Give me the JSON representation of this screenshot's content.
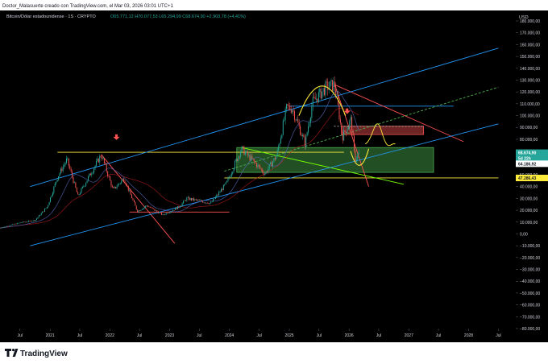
{
  "header": {
    "author_line": "Doctor_Malasuerte creado con TradingView.com, el Mar 03, 2026 03:01 UTC+1",
    "symbol": "Bitcoin/Dólar estadounidense · 1S · CRYPTO",
    "ohlc": "O65.771,12 H70.077,53 L65.294,99 C68.674,90 +2.903,78 (+4,41%)"
  },
  "footer": {
    "brand": "TradingView",
    "logo_icon": "tradingview-logo-icon"
  },
  "colors": {
    "background": "#000000",
    "up": "#26a69a",
    "down": "#ef5350",
    "channel": "#2196f3",
    "support_zone": "#4caf50",
    "annotation": "#ffeb3b",
    "trend_down": "#ff5252",
    "trend_up": "#76ff03"
  },
  "chart_data": {
    "type": "candlestick",
    "currency_label": "USD",
    "y_ticks": [
      "180.000,00",
      "170.000,00",
      "160.000,00",
      "150.000,00",
      "140.000,00",
      "130.000,00",
      "120.000,00",
      "110.000,00",
      "100.000,00",
      "90.000,00",
      "80.000,00",
      "70.000,00",
      "60.000,00",
      "50.000,00",
      "40.000,00",
      "30.000,00",
      "20.000,00",
      "10.000,00",
      "0,00",
      "−10.000,00",
      "−20.000,00",
      "−30.000,00",
      "−40.000,00",
      "−50.000,00",
      "−60.000,00",
      "−70.000,00",
      "−80.000,00"
    ],
    "ylim": [
      -80000,
      180000
    ],
    "x_ticks": [
      {
        "label": "Jul",
        "date": "2020-07-01"
      },
      {
        "label": "2021",
        "date": "2021-01-01"
      },
      {
        "label": "Jul",
        "date": "2021-07-01"
      },
      {
        "label": "2022",
        "date": "2022-01-01"
      },
      {
        "label": "Jul",
        "date": "2022-07-01"
      },
      {
        "label": "2023",
        "date": "2023-01-01"
      },
      {
        "label": "Jul",
        "date": "2023-07-01"
      },
      {
        "label": "2024",
        "date": "2024-01-01"
      },
      {
        "label": "Jul",
        "date": "2024-07-01"
      },
      {
        "label": "2025",
        "date": "2025-01-01"
      },
      {
        "label": "Jul",
        "date": "2025-07-01"
      },
      {
        "label": "2026",
        "date": "2026-01-01"
      },
      {
        "label": "Jul",
        "date": "2026-07-01"
      },
      {
        "label": "2027",
        "date": "2027-01-01"
      },
      {
        "label": "Jul",
        "date": "2027-07-01"
      },
      {
        "label": "2028",
        "date": "2028-01-01"
      },
      {
        "label": "Jul",
        "date": "2028-07-01"
      }
    ],
    "price_path": [
      [
        "2020-03-01",
        5000
      ],
      [
        "2020-07-01",
        9500
      ],
      [
        "2020-10-01",
        11500
      ],
      [
        "2020-12-15",
        23000
      ],
      [
        "2021-02-15",
        48000
      ],
      [
        "2021-04-14",
        63000
      ],
      [
        "2021-06-20",
        32000
      ],
      [
        "2021-08-20",
        47000
      ],
      [
        "2021-11-10",
        67000
      ],
      [
        "2022-01-20",
        37000
      ],
      [
        "2022-03-28",
        47000
      ],
      [
        "2022-06-18",
        19000
      ],
      [
        "2022-08-15",
        24000
      ],
      [
        "2022-11-20",
        16000
      ],
      [
        "2023-03-01",
        23000
      ],
      [
        "2023-04-15",
        30000
      ],
      [
        "2023-09-10",
        26000
      ],
      [
        "2023-12-15",
        43000
      ],
      [
        "2024-03-14",
        72000
      ],
      [
        "2024-08-05",
        51000
      ],
      [
        "2024-10-15",
        66000
      ],
      [
        "2024-12-17",
        107000
      ],
      [
        "2025-01-20",
        106000
      ],
      [
        "2025-04-07",
        76000
      ],
      [
        "2025-05-22",
        111000
      ],
      [
        "2025-08-14",
        124000
      ],
      [
        "2025-10-06",
        126000
      ],
      [
        "2025-11-21",
        82000
      ],
      [
        "2026-01-14",
        97000
      ],
      [
        "2026-02-05",
        62000
      ],
      [
        "2026-03-02",
        68674.9
      ]
    ],
    "price_labels": [
      {
        "text": "68.674,90",
        "value": 68674.9,
        "color": "#26a69a"
      },
      {
        "text": "5d 22h",
        "value": 63800,
        "color": "#26a69a"
      },
      {
        "text": "64.186,92",
        "value": 59300,
        "color": "#ffffff"
      },
      {
        "text": "47.286,43",
        "value": 47286.43,
        "color": "#ffeb3b"
      }
    ],
    "horizontal_levels": [
      {
        "value": 69000,
        "from": "2021-02-15",
        "to": "2025-12-01",
        "color": "#ffeb3b"
      },
      {
        "value": 47286.43,
        "from": "2023-12-01",
        "to": "2028-07-01",
        "color": "#ffeb3b"
      },
      {
        "value": 18500,
        "from": "2022-05-01",
        "to": "2024-01-01",
        "color": "#ff5252"
      },
      {
        "value": 108000,
        "from": "2025-01-01",
        "to": "2027-10-01",
        "color": "#2196f3"
      },
      {
        "value": 91000,
        "from": "2025-10-01",
        "to": "2027-04-01",
        "color": "#9e9e9e"
      }
    ],
    "zones": [
      {
        "from": "2024-02-15",
        "to": "2027-06-01",
        "low": 52000,
        "high": 73000,
        "color": "#4caf50"
      },
      {
        "from": "2025-11-15",
        "to": "2027-04-01",
        "low": 84000,
        "high": 91000,
        "color": "#ef5350"
      }
    ],
    "trendlines": [
      {
        "p1": [
          "2021-11-10",
          67000
        ],
        "p2": [
          "2023-02-01",
          -8000
        ],
        "color": "#ff5252"
      },
      {
        "p1": [
          "2025-10-06",
          126000
        ],
        "p2": [
          "2026-05-01",
          40000
        ],
        "color": "#ff5252"
      },
      {
        "p1": [
          "2025-10-06",
          126000
        ],
        "p2": [
          "2027-12-01",
          78000
        ],
        "color": "#ff5252"
      },
      {
        "p1": [
          "2024-03-14",
          73000
        ],
        "p2": [
          "2026-12-01",
          42000
        ],
        "color": "#76ff03"
      },
      {
        "p1": [
          "2020-09-01",
          -10000
        ],
        "p2": [
          "2028-07-01",
          93000
        ],
        "color": "#2196f3"
      },
      {
        "p1": [
          "2020-09-01",
          40000
        ],
        "p2": [
          "2028-07-01",
          157000
        ],
        "color": "#2196f3"
      },
      {
        "p1": [
          "2023-12-01",
          53000
        ],
        "p2": [
          "2028-07-01",
          124000
        ],
        "color": "#4caf50"
      }
    ],
    "arrows": [
      {
        "date": "2022-02-10",
        "value": 80000,
        "color": "#ff5252"
      },
      {
        "date": "2025-12-20",
        "value": 102000,
        "color": "#ff5252"
      }
    ]
  }
}
